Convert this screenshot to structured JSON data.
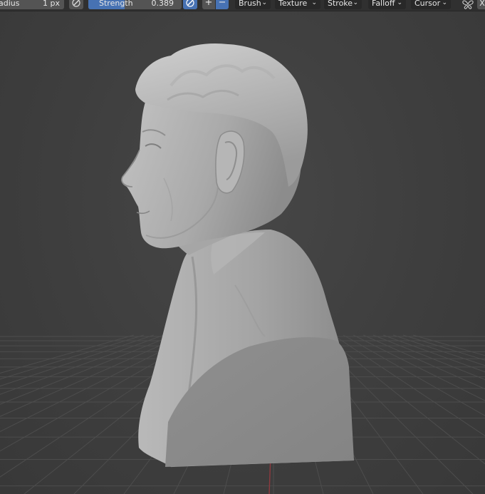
{
  "toolbar": {
    "radius_label": "adius",
    "radius_value": "1 px",
    "strength_label": "Strength",
    "strength_value": "0.389",
    "strength_fraction": 0.389,
    "add_label": "+",
    "subtract_label": "−",
    "brush_menu": "Brush",
    "texture_menu": "Texture",
    "stroke_menu": "Stroke",
    "falloff_menu": "Falloff",
    "cursor_menu": "Cursor",
    "axis_x_label": "X",
    "pressure_icon": "pen-pressure-icon",
    "symmetry_icon": "butterfly-symmetry-icon",
    "chevron_icon": "chevron-down-icon"
  },
  "colors": {
    "header_bg": "#303030",
    "field_bg": "#545454",
    "accent": "#4772b3",
    "viewport_bg": "#3d3d3d",
    "grid_line": "#4a4a4a",
    "x_axis": "#b0373f",
    "sculpt": "#a8a8a8"
  },
  "viewport": {
    "object": "sculpted bust"
  }
}
